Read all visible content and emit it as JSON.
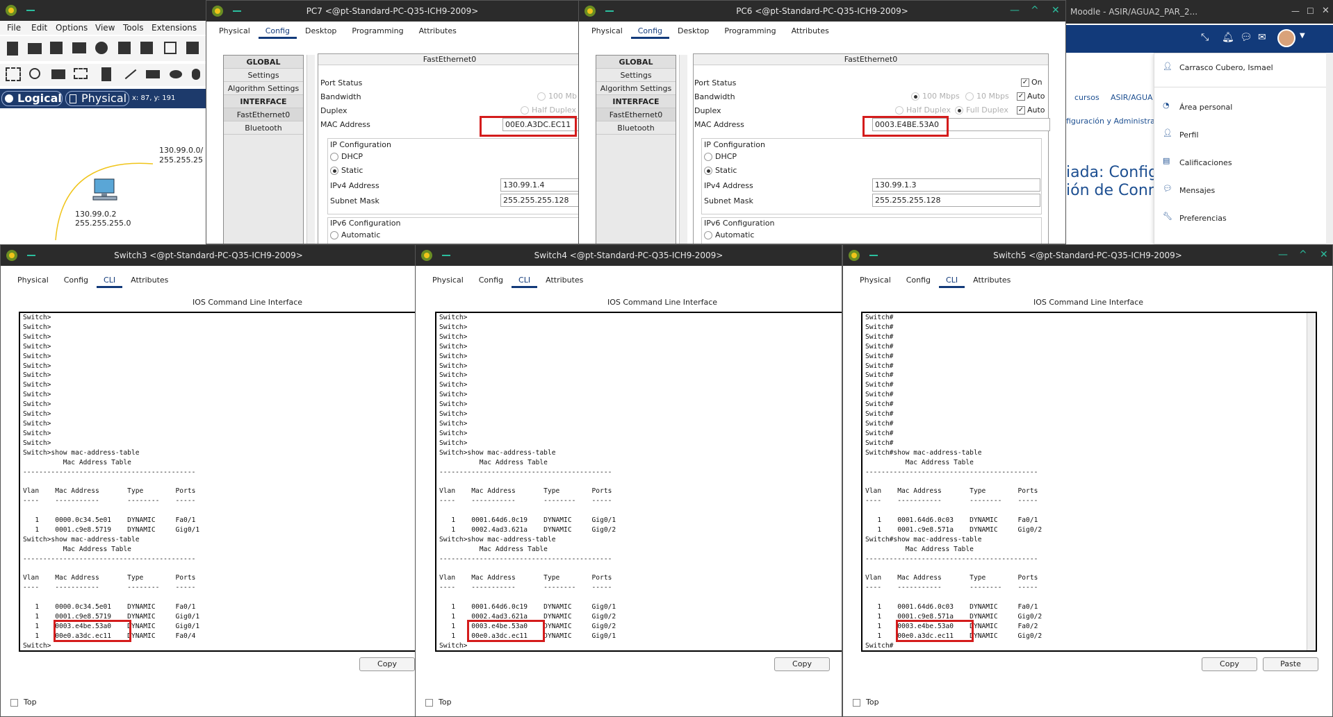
{
  "pt_main": {
    "menu": [
      "File",
      "Edit",
      "Options",
      "View",
      "Tools",
      "Extensions"
    ],
    "logical": "Logical",
    "physical": "Physical",
    "coords": "x: 87, y: 191",
    "net_label1": "130.99.0.0/",
    "net_label2": "255.255.25",
    "pc_ip": "130.99.0.2",
    "pc_mask": "255.255.255.0"
  },
  "pc7": {
    "title": "PC7 <@pt-Standard-PC-Q35-ICH9-2009>",
    "tabs": [
      "Physical",
      "Config",
      "Desktop",
      "Programming",
      "Attributes"
    ],
    "left": [
      "GLOBAL",
      "Settings",
      "Algorithm Settings",
      "INTERFACE",
      "FastEthernet0",
      "Bluetooth"
    ],
    "iface": "FastEthernet0",
    "port_status": "Port Status",
    "bandwidth": "Bandwidth",
    "bw_opt": "100 Mb",
    "duplex": "Duplex",
    "duplex_opt": "Half Duplex",
    "mac_label": "MAC Address",
    "mac": "00E0.A3DC.EC11",
    "ipconf": "IP Configuration",
    "dhcp": "DHCP",
    "static": "Static",
    "ipv4_label": "IPv4 Address",
    "ipv4": "130.99.1.4",
    "mask_label": "Subnet Mask",
    "mask": "255.255.255.128",
    "ipv6conf": "IPv6 Configuration",
    "automatic": "Automatic"
  },
  "pc6": {
    "title": "PC6 <@pt-Standard-PC-Q35-ICH9-2009>",
    "tabs": [
      "Physical",
      "Config",
      "Desktop",
      "Programming",
      "Attributes"
    ],
    "left": [
      "GLOBAL",
      "Settings",
      "Algorithm Settings",
      "INTERFACE",
      "FastEthernet0",
      "Bluetooth"
    ],
    "iface": "FastEthernet0",
    "port_status": "Port Status",
    "on": "On",
    "bandwidth": "Bandwidth",
    "bw1": "100 Mbps",
    "bw2": "10 Mbps",
    "auto": "Auto",
    "duplex": "Duplex",
    "half": "Half Duplex",
    "full": "Full Duplex",
    "mac_label": "MAC Address",
    "mac": "0003.E4BE.53A0",
    "ipconf": "IP Configuration",
    "dhcp": "DHCP",
    "static": "Static",
    "ipv4_label": "IPv4 Address",
    "ipv4": "130.99.1.3",
    "mask_label": "Subnet Mask",
    "mask": "255.255.255.128",
    "ipv6conf": "IPv6 Configuration",
    "automatic": "Automatic"
  },
  "moodle": {
    "title": "Moodle - ASIR/AGUA2_PAR_2...",
    "user": "Carrasco Cubero, Ismael",
    "menu": [
      "Área personal",
      "Perfil",
      "Calificaciones",
      "Mensajes",
      "Preferencias"
    ],
    "crumb1": "cursos",
    "crumb2": "ASIR/AGUA",
    "crumb3": "figuración y Administrac",
    "heading1": "iada: Configur",
    "heading2": "ión de Conmu"
  },
  "switch3": {
    "title": "Switch3 <@pt-Standard-PC-Q35-ICH9-2009>",
    "tabs": [
      "Physical",
      "Config",
      "CLI",
      "Attributes"
    ],
    "cli_title": "IOS Command Line Interface",
    "cli": "Switch>\nSwitch>\nSwitch>\nSwitch>\nSwitch>\nSwitch>\nSwitch>\nSwitch>\nSwitch>\nSwitch>\nSwitch>\nSwitch>\nSwitch>\nSwitch>\nSwitch>show mac-address-table\n          Mac Address Table\n-------------------------------------------\n\nVlan    Mac Address       Type        Ports\n----    -----------       --------    -----\n\n   1    0000.0c34.5e01    DYNAMIC     Fa0/1\n   1    0001.c9e8.5719    DYNAMIC     Gig0/1\nSwitch>show mac-address-table\n          Mac Address Table\n-------------------------------------------\n\nVlan    Mac Address       Type        Ports\n----    -----------       --------    -----\n\n   1    0000.0c34.5e01    DYNAMIC     Fa0/1\n   1    0001.c9e8.5719    DYNAMIC     Gig0/1\n   1    0003.e4be.53a0    DYNAMIC     Gig0/1\n   1    00e0.a3dc.ec11    DYNAMIC     Fa0/4\nSwitch>",
    "copy": "Copy",
    "top": "Top"
  },
  "switch4": {
    "title": "Switch4 <@pt-Standard-PC-Q35-ICH9-2009>",
    "tabs": [
      "Physical",
      "Config",
      "CLI",
      "Attributes"
    ],
    "cli_title": "IOS Command Line Interface",
    "cli": "Switch>\nSwitch>\nSwitch>\nSwitch>\nSwitch>\nSwitch>\nSwitch>\nSwitch>\nSwitch>\nSwitch>\nSwitch>\nSwitch>\nSwitch>\nSwitch>\nSwitch>show mac-address-table\n          Mac Address Table\n-------------------------------------------\n\nVlan    Mac Address       Type        Ports\n----    -----------       --------    -----\n\n   1    0001.64d6.0c19    DYNAMIC     Gig0/1\n   1    0002.4ad3.621a    DYNAMIC     Gig0/2\nSwitch>show mac-address-table\n          Mac Address Table\n-------------------------------------------\n\nVlan    Mac Address       Type        Ports\n----    -----------       --------    -----\n\n   1    0001.64d6.0c19    DYNAMIC     Gig0/1\n   1    0002.4ad3.621a    DYNAMIC     Gig0/2\n   1    0003.e4be.53a0    DYNAMIC     Gig0/2\n   1    00e0.a3dc.ec11    DYNAMIC     Gig0/1\nSwitch>",
    "copy": "Copy",
    "top": "Top"
  },
  "switch5": {
    "title": "Switch5 <@pt-Standard-PC-Q35-ICH9-2009>",
    "tabs": [
      "Physical",
      "Config",
      "CLI",
      "Attributes"
    ],
    "cli_title": "IOS Command Line Interface",
    "cli": "Switch#\nSwitch#\nSwitch#\nSwitch#\nSwitch#\nSwitch#\nSwitch#\nSwitch#\nSwitch#\nSwitch#\nSwitch#\nSwitch#\nSwitch#\nSwitch#\nSwitch#show mac-address-table\n          Mac Address Table\n-------------------------------------------\n\nVlan    Mac Address       Type        Ports\n----    -----------       --------    -----\n\n   1    0001.64d6.0c03    DYNAMIC     Fa0/1\n   1    0001.c9e8.571a    DYNAMIC     Gig0/2\nSwitch#show mac-address-table\n          Mac Address Table\n-------------------------------------------\n\nVlan    Mac Address       Type        Ports\n----    -----------       --------    -----\n\n   1    0001.64d6.0c03    DYNAMIC     Fa0/1\n   1    0001.c9e8.571a    DYNAMIC     Gig0/2\n   1    0003.e4be.53a0    DYNAMIC     Fa0/2\n   1    00e0.a3dc.ec11    DYNAMIC     Gig0/2\nSwitch#",
    "copy": "Copy",
    "paste": "Paste",
    "top": "Top"
  }
}
